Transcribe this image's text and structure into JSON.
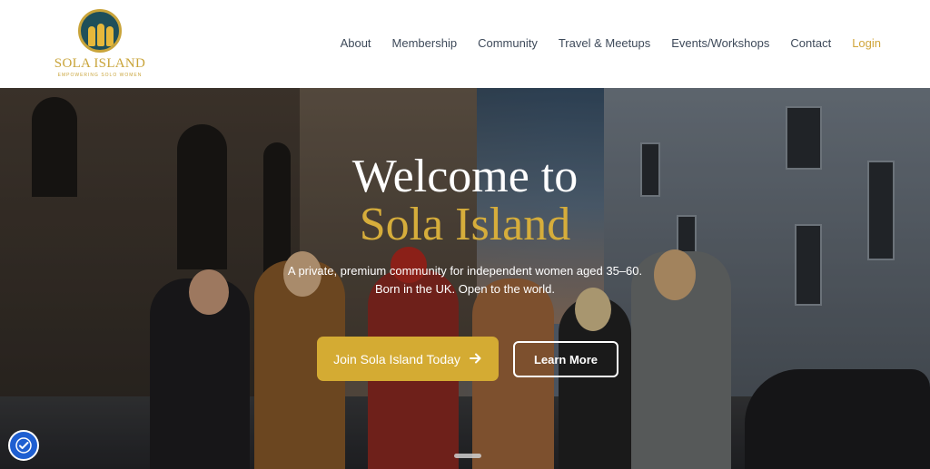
{
  "logo": {
    "name": "SOLA ISLAND",
    "tagline": "EMPOWERING SOLO WOMEN"
  },
  "nav": {
    "items": [
      "About",
      "Membership",
      "Community",
      "Travel & Meetups",
      "Events/Workshops",
      "Contact"
    ],
    "login": "Login"
  },
  "hero": {
    "title_line1": "Welcome to",
    "title_line2": "Sola Island",
    "subtitle_line1": "A private, premium community for independent women aged 35–60.",
    "subtitle_line2": "Born in the UK. Open to the world.",
    "primary_button": "Join Sola Island Today",
    "primary_button_icon": "arrow-right-icon",
    "secondary_button": "Learn More"
  },
  "colors": {
    "gold": "#d4ab33",
    "nav_text": "#3e4a5a",
    "accessibility_blue": "#1f5fd1"
  },
  "accessibility_icon": "accessibility-icon"
}
